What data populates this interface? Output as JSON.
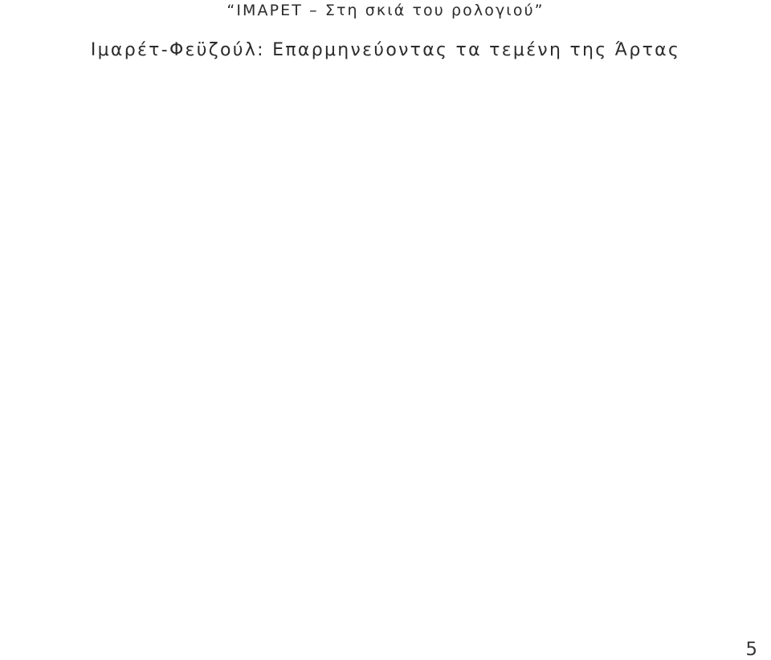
{
  "document": {
    "page_number": "5",
    "text_color": "#2b2b2b",
    "background_color": "#ffffff"
  },
  "slide": {
    "title": "“ΙΜΑΡΕΤ – Στη σκιά του ρολογιού”",
    "subtitle": "Ιμαρέτ-Φεϋζούλ: Επαρμηνεύοντας τα τεμένη της Άρτας",
    "body_text": ""
  },
  "footer": {
    "page_number": "5"
  }
}
